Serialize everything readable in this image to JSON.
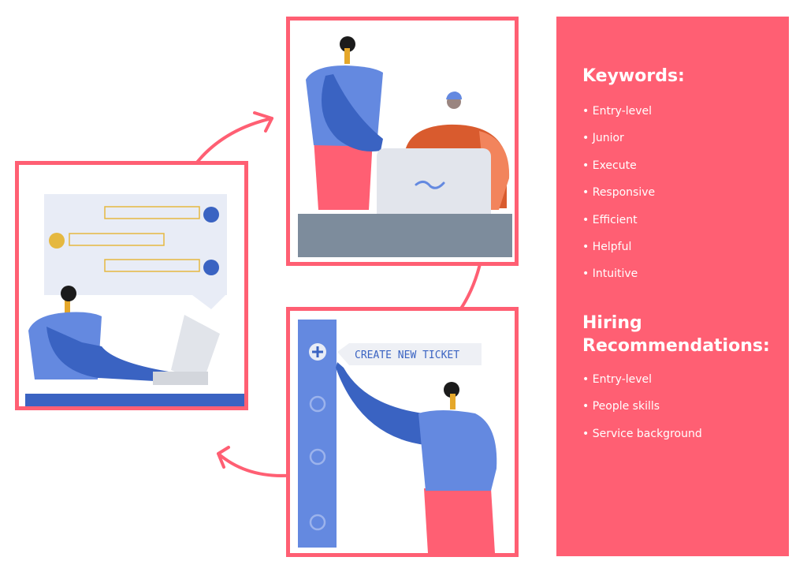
{
  "colors": {
    "accent_pink": "#ff5f73",
    "blue_light": "#6489e0",
    "blue_dark": "#3a63c2",
    "skin": "#e5a72a",
    "hair": "#1b1b1b",
    "chat_bg": "#e8ecf6",
    "desk_gray": "#7d8c9c",
    "orange": "#d95b2e",
    "orange_light": "#f2845c"
  },
  "scenes": {
    "chat": {
      "name": "Person typing on laptop with chat conversation"
    },
    "collab": {
      "name": "Two people working at a laptop on a desk"
    },
    "ticket": {
      "name": "Person pressing create new ticket button",
      "button_label": "CREATE NEW TICKET"
    }
  },
  "sidebar": {
    "keywords_title": "Keywords:",
    "keywords": [
      "Entry-level",
      "Junior",
      "Execute",
      "Responsive",
      "Efficient",
      "Helpful",
      "Intuitive"
    ],
    "hiring_title_line1": "Hiring",
    "hiring_title_line2": "Recommendations:",
    "hiring": [
      "Entry-level",
      "People skills",
      "Service background"
    ]
  }
}
